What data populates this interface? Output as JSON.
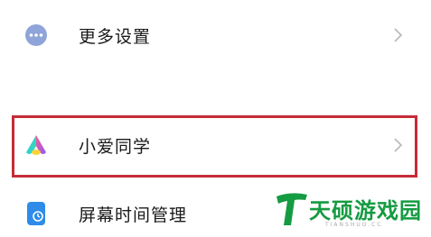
{
  "settings": {
    "items": [
      {
        "label": "更多设置",
        "icon": "more-dots-icon"
      },
      {
        "label": "小爱同学",
        "icon": "xiaoai-icon"
      },
      {
        "label": "屏幕时间管理",
        "icon": "screen-time-icon"
      }
    ]
  },
  "watermark": {
    "brand": "天硕游戏园",
    "sub": "TIANSHUO.CC"
  },
  "colors": {
    "highlight": "#c62b37",
    "more_icon": "#8fa4d8",
    "screen_time_icon": "#2e8ce8",
    "watermark": "#159b41"
  }
}
